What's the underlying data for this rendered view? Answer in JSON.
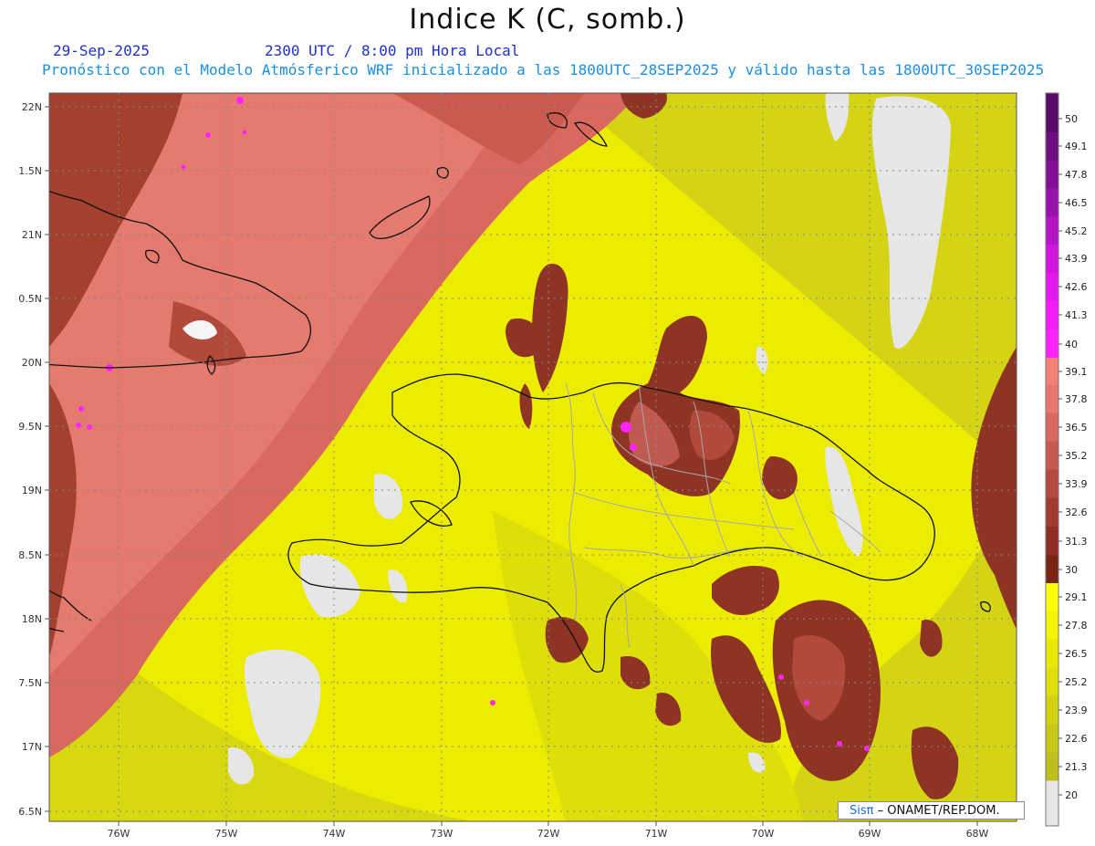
{
  "header": {
    "title": "Indice K (C, somb.)",
    "date": "29-Sep-2025",
    "time": "2300 UTC / 8:00 pm Hora Local",
    "subtitle": "Pronóstico con el Modelo Atmósferico WRF inicializado a las 1800UTC_28SEP2025 y válido hasta las  1800UTC_30SEP2025"
  },
  "axes": {
    "lat_labels": [
      "22N",
      "1.5N",
      "21N",
      "0.5N",
      "20N",
      "9.5N",
      "19N",
      "8.5N",
      "18N",
      "7.5N",
      "17N",
      "6.5N"
    ],
    "lon_labels": [
      "76W",
      "75W",
      "74W",
      "73W",
      "72W",
      "71W",
      "70W",
      "69W",
      "68W"
    ]
  },
  "colorbar": {
    "labels": [
      "50",
      "49.1",
      "47.8",
      "46.5",
      "45.2",
      "43.9",
      "42.6",
      "41.3",
      "40",
      "39.1",
      "37.8",
      "36.5",
      "35.2",
      "33.9",
      "32.6",
      "31.3",
      "30",
      "29.1",
      "27.8",
      "26.5",
      "25.2",
      "23.9",
      "22.6",
      "21.3",
      "20"
    ],
    "colors": [
      "#5a0a6a",
      "#6e0e80",
      "#820f96",
      "#9a12ae",
      "#b414c6",
      "#ce16dc",
      "#e418ec",
      "#f41cfa",
      "#ff24ff",
      "#f68078",
      "#e8766e",
      "#d86860",
      "#c65a52",
      "#b44a42",
      "#a23c32",
      "#8e2e24",
      "#7a2414",
      "#ffff00",
      "#f4f400",
      "#e8e800",
      "#dede08",
      "#d2d210",
      "#c8c818",
      "#bebe1e",
      "#e6e6e6"
    ]
  },
  "footer": {
    "credit_brand": "Sisπ",
    "credit_text": "– ONAMET/REP.DOM."
  },
  "colors": {
    "ocean_high": "#e07064",
    "ocean_brown": "#8e3424",
    "yellow": "#f0f000",
    "olive": "#c8c820",
    "missing": "#e6e6e6",
    "magenta": "#ff24ff",
    "coast": "#111111",
    "province": "#a0a0a0"
  }
}
